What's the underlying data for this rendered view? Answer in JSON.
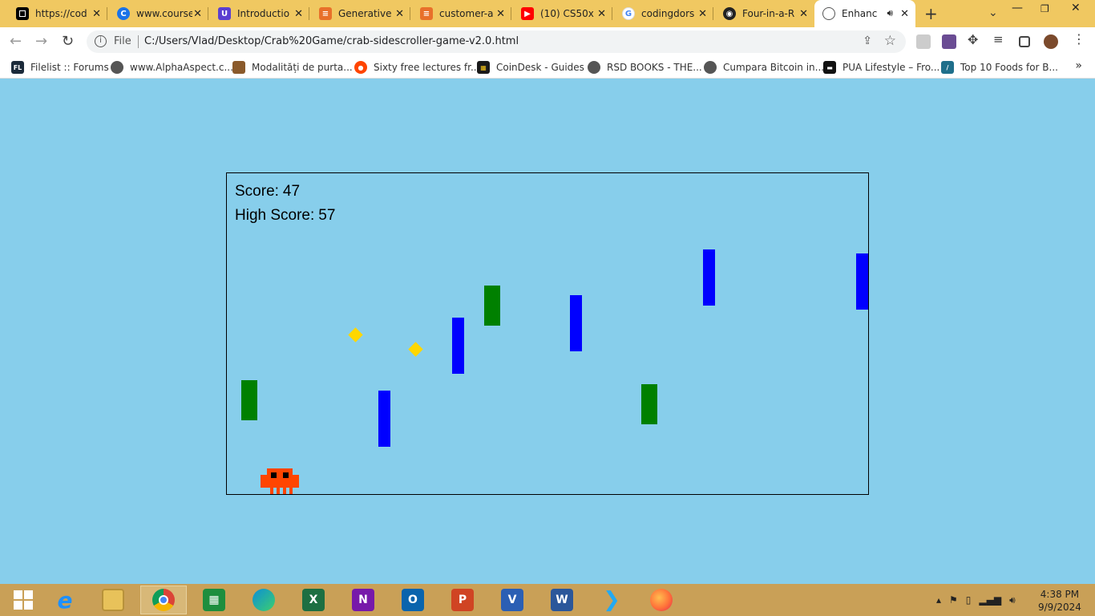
{
  "browser": {
    "tabs": [
      {
        "title": "https://cod",
        "favicon": "square-icon",
        "color": "#000000"
      },
      {
        "title": "www.course",
        "favicon": "c-logo-icon",
        "color": "#1a73e8"
      },
      {
        "title": "Introductio",
        "favicon": "u-logo-icon",
        "color": "#5b3fd1"
      },
      {
        "title": "Generative",
        "favicon": "layers-icon",
        "color": "#e8702a"
      },
      {
        "title": "customer-a",
        "favicon": "layers-icon",
        "color": "#e8702a"
      },
      {
        "title": "(10) CS50x",
        "favicon": "youtube-icon",
        "color": "#ff0000"
      },
      {
        "title": "codingdors",
        "favicon": "google-icon",
        "color": "#4285f4"
      },
      {
        "title": "Four-in-a-R",
        "favicon": "github-icon",
        "color": "#222222"
      },
      {
        "title": "Enhanc",
        "favicon": "globe-icon",
        "color": "#555555",
        "active": true
      }
    ],
    "address": {
      "scheme": "File",
      "url": "C:/Users/Vlad/Desktop/Crab%20Game/crab-sidescroller-game-v2.0.html"
    },
    "bookmarks": [
      {
        "label": "Filelist :: Forums",
        "icon": "fl-icon",
        "color": "#1b2a3a"
      },
      {
        "label": "www.AlphaAspect.c...",
        "icon": "globe-icon",
        "color": "#555555"
      },
      {
        "label": "Modalități de purta...",
        "icon": "pixel-icon",
        "color": "#8a5a2b"
      },
      {
        "label": "Sixty free lectures fr...",
        "icon": "reddit-icon",
        "color": "#ff4500"
      },
      {
        "label": "CoinDesk - Guides",
        "icon": "coindesk-icon",
        "color": "#1a1a1a"
      },
      {
        "label": "RSD BOOKS - THE...",
        "icon": "globe-icon",
        "color": "#555555"
      },
      {
        "label": "Cumpara Bitcoin in...",
        "icon": "globe-icon",
        "color": "#555555"
      },
      {
        "label": "PUA Lifestyle – Fro...",
        "icon": "pua-icon",
        "color": "#111111"
      },
      {
        "label": "Top 10 Foods for B...",
        "icon": "slash-icon",
        "color": "#1f6f8b"
      }
    ],
    "bookmarks_more": "»"
  },
  "game": {
    "score_label": "Score:",
    "score": "47",
    "high_score_label": "High Score:",
    "high_score": "57",
    "colors": {
      "background": "#87CEEB",
      "obstacle_blue": "#0000FF",
      "obstacle_green": "#008000",
      "coin": "#FFD700",
      "crab": "#FF4500"
    }
  },
  "taskbar": {
    "apps": [
      {
        "name": "internet-explorer-icon",
        "letter": "e",
        "color": "#1e90ff"
      },
      {
        "name": "file-explorer-icon",
        "letter": "",
        "color": "#e8c25a"
      },
      {
        "name": "chrome-icon",
        "letter": "",
        "color": "#db4437",
        "active": true
      },
      {
        "name": "store-icon",
        "letter": "",
        "color": "#1e8e3e"
      },
      {
        "name": "edge-icon",
        "letter": "",
        "color": "#0c8fd6"
      },
      {
        "name": "excel-icon",
        "letter": "X",
        "color": "#1d6f42"
      },
      {
        "name": "onenote-icon",
        "letter": "N",
        "color": "#7719aa"
      },
      {
        "name": "outlook-icon",
        "letter": "O",
        "color": "#0a64ad"
      },
      {
        "name": "powerpoint-icon",
        "letter": "P",
        "color": "#d04423"
      },
      {
        "name": "visio-icon",
        "letter": "V",
        "color": "#2b5fb4"
      },
      {
        "name": "word-icon",
        "letter": "W",
        "color": "#2b579a"
      },
      {
        "name": "vscode-icon",
        "letter": "",
        "color": "#23a9f2"
      },
      {
        "name": "firefox-icon",
        "letter": "",
        "color": "#ff7139"
      }
    ],
    "clock": {
      "time": "4:38 PM",
      "date": "9/9/2024"
    }
  }
}
